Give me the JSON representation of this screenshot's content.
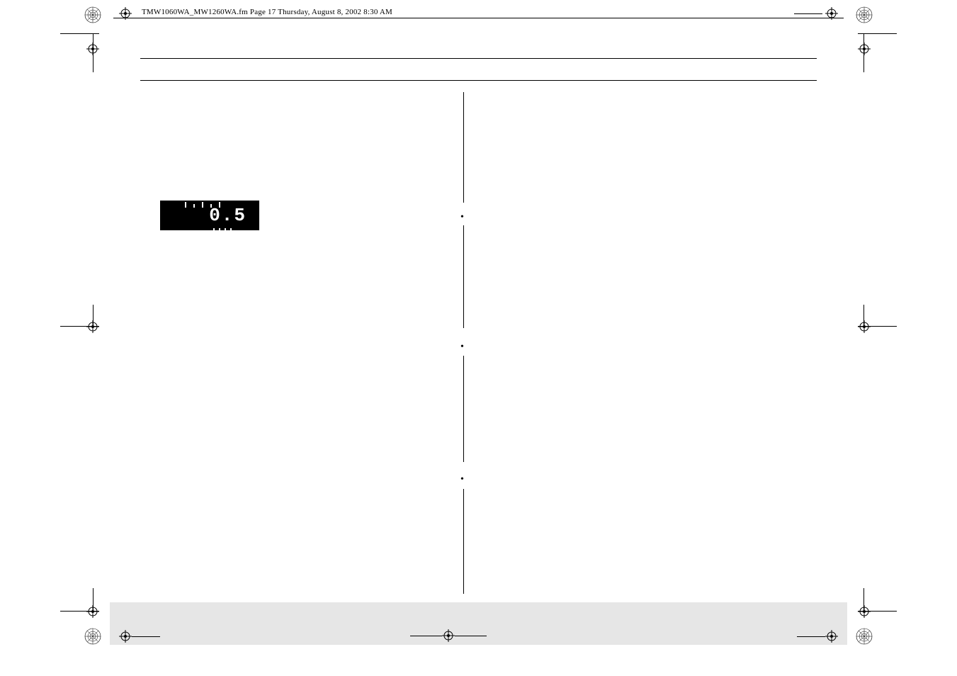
{
  "header_text": "TMW1060WA_MW1260WA.fm  Page 17  Thursday, August 8, 2002  8:30 AM",
  "lcd_reading": "0.5",
  "bullets": [
    "•",
    "•",
    "•"
  ]
}
